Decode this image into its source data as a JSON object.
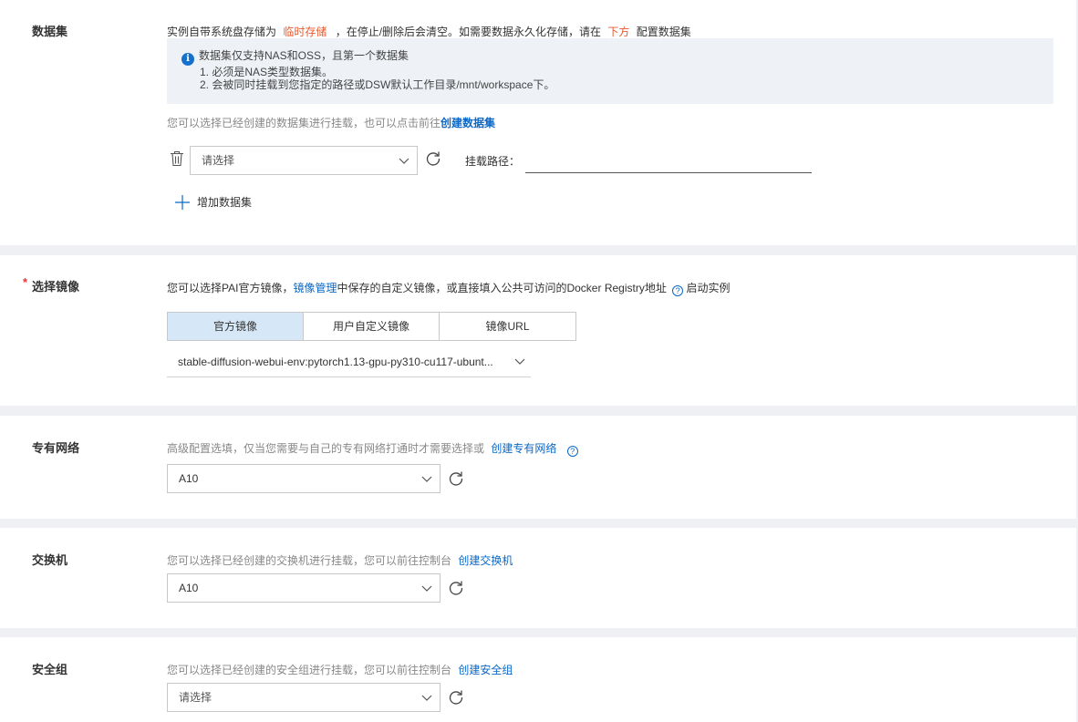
{
  "dataset": {
    "label": "数据集",
    "desc_prefix": "实例自带系统盘存储为",
    "desc_temp": "临时存储",
    "desc_mid": "，在停止/删除后会清空。如需要数据永久化存储，请在",
    "desc_below": "下方",
    "desc_suffix": "配置数据集",
    "notice_title": "数据集仅支持NAS和OSS，且第一个数据集",
    "notice_line1": "1. 必须是NAS类型数据集。",
    "notice_line2": "2. 会被同时挂载到您指定的路径或DSW默认工作目录/mnt/workspace下。",
    "hint_prefix": "您可以选择已经创建的数据集进行挂载，也可以点击前往",
    "hint_link": "创建数据集",
    "select_placeholder": "请选择",
    "mount_label": "挂载路径：",
    "mount_value": "",
    "add_label": "增加数据集"
  },
  "image": {
    "label": "选择镜像",
    "required_mark": "*",
    "desc_prefix": "您可以选择PAI官方镜像，",
    "desc_link": "镜像管理",
    "desc_suffix": "中保存的自定义镜像，或直接填入公共可访问的Docker Registry地址",
    "desc_end": "启动实例",
    "tabs": [
      "官方镜像",
      "用户自定义镜像",
      "镜像URL"
    ],
    "active_tab": 0,
    "selected": "stable-diffusion-webui-env:pytorch1.13-gpu-py310-cu117-ubunt..."
  },
  "vpc": {
    "label": "专有网络",
    "desc": "高级配置选填，仅当您需要与自己的专有网络打通时才需要选择或",
    "link": "创建专有网络",
    "selected": "A10"
  },
  "vswitch": {
    "label": "交换机",
    "desc": "您可以选择已经创建的交换机进行挂载，您可以前往控制台",
    "link": "创建交换机",
    "selected": "A10"
  },
  "security_group": {
    "label": "安全组",
    "desc": "您可以选择已经创建的安全组进行挂载，您可以前往控制台",
    "link": "创建安全组",
    "selected": "请选择"
  },
  "icons": {
    "info": "i",
    "question": "?"
  },
  "colors": {
    "accent": "#0b68c6",
    "warning": "#e85a2f",
    "required": "#e33333",
    "active_tab": "#d6e8f7"
  }
}
